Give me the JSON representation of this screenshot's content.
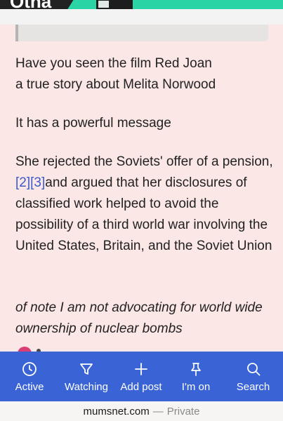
{
  "banner": {
    "logo_text": "Otha"
  },
  "post": {
    "paragraph1_line1": "Have you seen the film Red Joan",
    "paragraph1_line2": "a true story about Melita Norwood",
    "paragraph2": "It has a powerful message",
    "paragraph3_before": "She rejected the Soviets' offer of a pension,",
    "ref1": "[2]",
    "ref2": "[3]",
    "paragraph3_after": "and argued that her disclosures of classified work helped to avoid the possibility of a third world war involving the United States, Britain, and the Soviet Union",
    "paragraph4": "of note I am not advocating for world wide ownership of nuclear bombs"
  },
  "nav": {
    "items": [
      {
        "label": "Active",
        "icon": "clock-icon"
      },
      {
        "label": "Watching",
        "icon": "funnel-icon"
      },
      {
        "label": "Add post",
        "icon": "plus-icon"
      },
      {
        "label": "I'm on",
        "icon": "pin-icon"
      },
      {
        "label": "Search",
        "icon": "search-icon"
      }
    ]
  },
  "url_bar": {
    "domain": "mumsnet.com",
    "separator": "—",
    "mode": "Private"
  },
  "colors": {
    "accent": "#3a64d6",
    "post_bg": "#fce7e7",
    "link": "#3c5bc9",
    "banner": "#2ad4a4"
  }
}
